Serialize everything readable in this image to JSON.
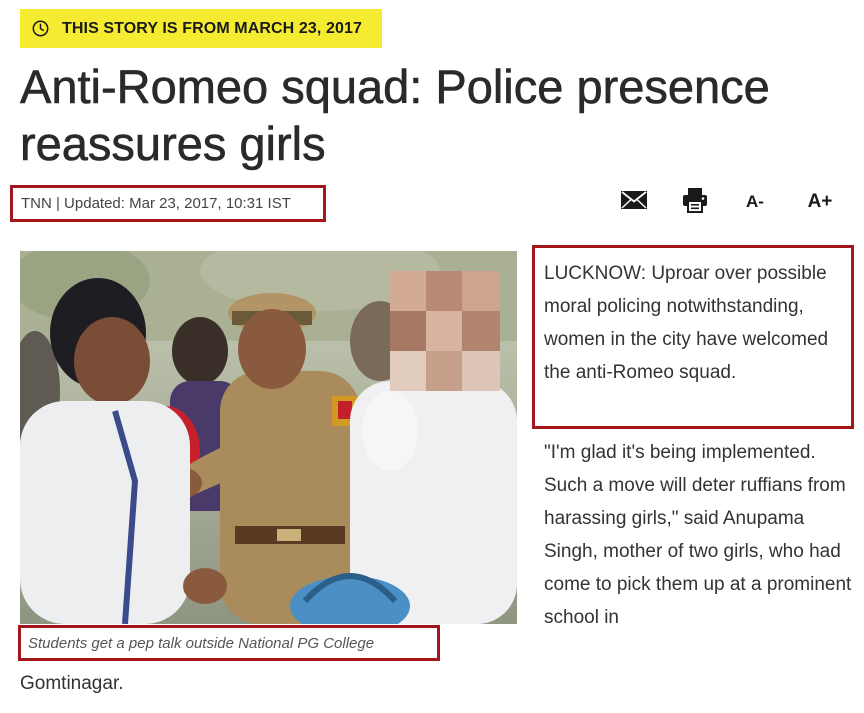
{
  "banner": {
    "icon": "clock-icon",
    "text": "THIS STORY IS FROM MARCH 23, 2017",
    "background": "#f5ec32"
  },
  "article": {
    "headline": "Anti-Romeo squad: Police presence reassures girls",
    "byline": "TNN | Updated: Mar 23, 2017, 10:31 IST",
    "lead": "LUCKNOW: Uproar over possible moral policing notwithstanding, women in the city have welcomed the anti-Romeo squad.",
    "body": "\"I'm glad it's being implemented. Such a move will deter ruffians from harassing girls,\" said Anupama Singh, mother of two girls, who had come to pick them up at a prominent school in",
    "body_continued": "Gomtinagar."
  },
  "toolbar": {
    "email_icon": "email-icon",
    "print_icon": "printer-icon",
    "font_decrease": "A-",
    "font_increase": "A+"
  },
  "photo": {
    "caption": "Students get a pep talk outside National PG College"
  },
  "colors": {
    "highlight_border": "#a3161c",
    "text": "#333333"
  }
}
